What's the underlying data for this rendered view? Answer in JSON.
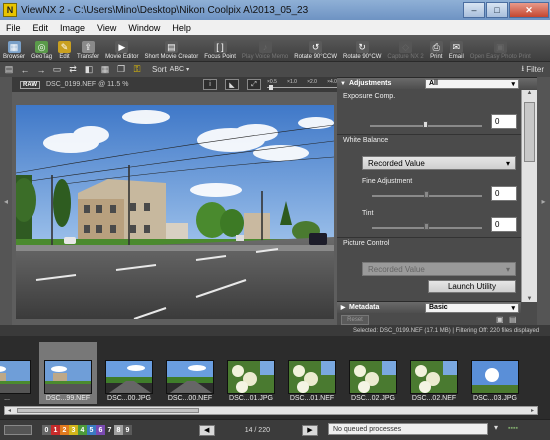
{
  "window": {
    "title": "ViewNX 2 - C:\\Users\\Mino\\Desktop\\Nikon Coolpix A\\2013_05_23",
    "app_icon": "N"
  },
  "menu": [
    "File",
    "Edit",
    "Image",
    "View",
    "Window",
    "Help"
  ],
  "toolbar": [
    {
      "label": "Browser",
      "icon": "browser-icon",
      "glyph": "▦",
      "color": "#7aa0c8"
    },
    {
      "label": "GeoTag",
      "icon": "geotag-icon",
      "glyph": "◎",
      "color": "#5a9a4a"
    },
    {
      "label": "Edit",
      "icon": "edit-icon",
      "glyph": "✎",
      "color": "#c9a020"
    },
    {
      "label": "Transfer",
      "icon": "transfer-icon",
      "glyph": "⇪",
      "color": "#8a8a8a"
    },
    {
      "label": "Movie Editor",
      "icon": "movie-editor-icon",
      "glyph": "▶",
      "color": "#5a5a5a"
    },
    {
      "label": "Short Movie Creator",
      "icon": "short-movie-icon",
      "glyph": "▤",
      "color": "#5a5a5a"
    },
    {
      "label": "Focus Point",
      "icon": "focus-point-icon",
      "glyph": "[ ]",
      "color": "#5a5a5a"
    },
    {
      "label": "Play Voice Memo",
      "icon": "voice-memo-icon",
      "glyph": "♪",
      "color": "#555",
      "disabled": true
    },
    {
      "label": "Rotate 90°CCW",
      "icon": "rotate-ccw-icon",
      "glyph": "↺",
      "color": "#5a5a5a"
    },
    {
      "label": "Rotate 90°CW",
      "icon": "rotate-cw-icon",
      "glyph": "↻",
      "color": "#5a5a5a"
    },
    {
      "label": "Capture NX 2",
      "icon": "capture-nx-icon",
      "glyph": "◇",
      "color": "#555",
      "disabled": true
    },
    {
      "label": "Print",
      "icon": "print-icon",
      "glyph": "⎙",
      "color": "#5a5a5a"
    },
    {
      "label": "Email",
      "icon": "email-icon",
      "glyph": "✉",
      "color": "#5a5a5a"
    },
    {
      "label": "Open Easy Photo Print",
      "icon": "easy-print-icon",
      "glyph": "▣",
      "color": "#555",
      "disabled": true
    }
  ],
  "toolbar2": {
    "sort_label": "Sort",
    "sort_value": "ABC",
    "filter_label": "Filter"
  },
  "viewer": {
    "raw_badge": "RAW",
    "file_info": "DSC_0199.NEF @ 11.5 %",
    "zoom_levels": [
      "×0.5",
      "×1.0",
      "×2.0",
      "×4.0"
    ]
  },
  "adjustments": {
    "header": "Adjustments",
    "header_select": "All",
    "exposure_label": "Exposure Comp.",
    "exposure_value": "0",
    "exposure_level": 0.5,
    "wb_label": "White Balance",
    "wb_value": "Recorded Value",
    "fine_label": "Fine Adjustment",
    "fine_value": "0",
    "fine_level": 0.5,
    "tint_label": "Tint",
    "tint_value": "0",
    "tint_level": 0.5,
    "pc_label": "Picture Control",
    "pc_value": "Recorded Value",
    "launch_button": "Launch Utility"
  },
  "metadata": {
    "header": "Metadata",
    "select": "Basic"
  },
  "reset_label": "Reset",
  "status_line": "Selected: DSC_0199.NEF (17.1 MB) | Filtering Off: 220 files displayed",
  "filmstrip": [
    {
      "label": "...",
      "scene": "town",
      "selected": false
    },
    {
      "label": "DSC...99.NEF",
      "scene": "town",
      "selected": true
    },
    {
      "label": "DSC...00.JPG",
      "scene": "road",
      "selected": false
    },
    {
      "label": "DSC...00.NEF",
      "scene": "road",
      "selected": false
    },
    {
      "label": "DSC...01.JPG",
      "scene": "flowers",
      "selected": false
    },
    {
      "label": "DSC...01.NEF",
      "scene": "flowers",
      "selected": false
    },
    {
      "label": "DSC...02.JPG",
      "scene": "flowers",
      "selected": false
    },
    {
      "label": "DSC...02.NEF",
      "scene": "flowers",
      "selected": false
    },
    {
      "label": "DSC...03.JPG",
      "scene": "sun",
      "selected": false
    }
  ],
  "labels": [
    "0",
    "1",
    "2",
    "3",
    "4",
    "5",
    "6",
    "7",
    "8",
    "9"
  ],
  "label_colors": [
    "#666",
    "#c62b2b",
    "#e07a1e",
    "#d3b51b",
    "#4d9a3a",
    "#3a7ac0",
    "#7a4ab0",
    "#3a3a3a",
    "#a0a0a0",
    "#5a5a5a"
  ],
  "page_counter": "14 / 220",
  "queue_status": "No queued processes",
  "colors": {
    "accent": "#6e93c3",
    "sky": "#5e8fd0",
    "grass": "#4b8a2e"
  }
}
